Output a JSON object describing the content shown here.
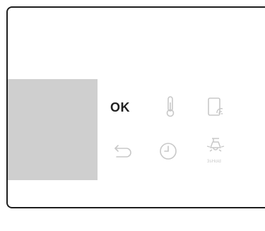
{
  "control_panel": {
    "ok_label": "OK",
    "icons": {
      "thermometer": "thermometer-icon",
      "remote": "remote-tablet-wifi-icon",
      "back": "back-arrow-icon",
      "timer": "clock-timer-icon",
      "light": "lamp-icon"
    },
    "light_caption": "3sHold"
  },
  "colors": {
    "frame": "#1e1e1e",
    "display": "#cfcfcf",
    "ok_text": "#222222",
    "icon_inactive": "#c8c8c8"
  }
}
